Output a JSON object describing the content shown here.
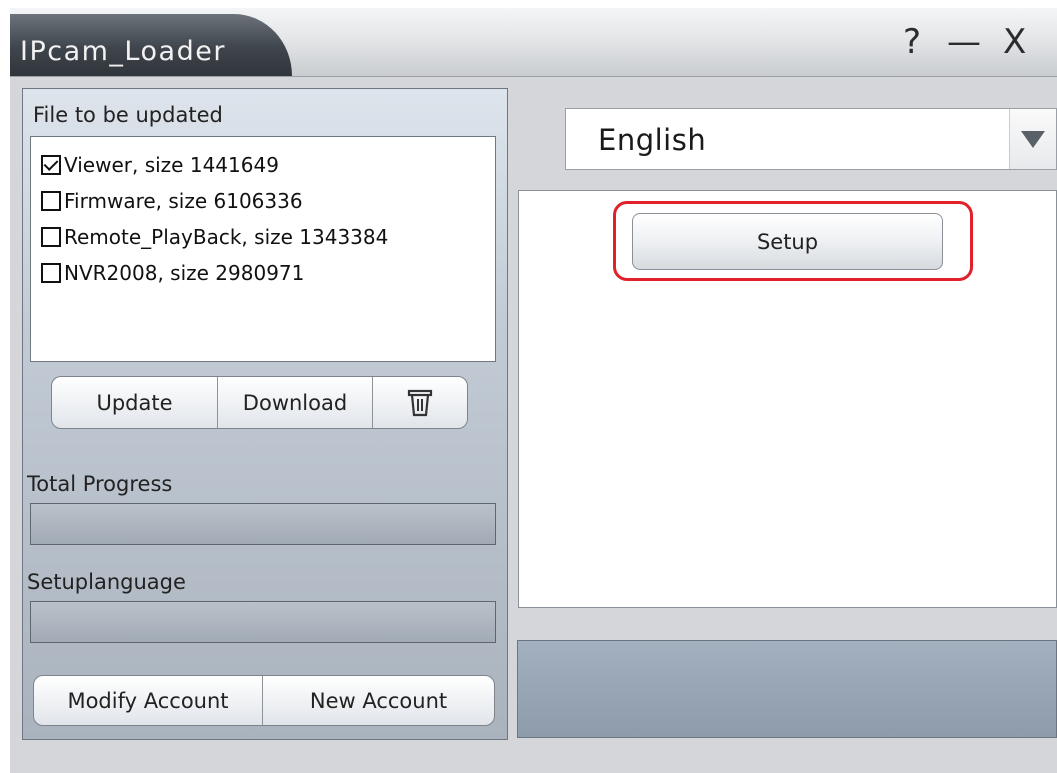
{
  "window": {
    "title": "IPcam_Loader",
    "controls": {
      "help": "?",
      "minimize": "—",
      "close": "X"
    }
  },
  "files": {
    "heading": "File to be updated",
    "items": [
      {
        "label": "Viewer, size 1441649",
        "checked": true
      },
      {
        "label": "Firmware, size 6106336",
        "checked": false
      },
      {
        "label": "Remote_PlayBack, size 1343384",
        "checked": false
      },
      {
        "label": "NVR2008, size 2980971",
        "checked": false
      }
    ]
  },
  "actions": {
    "update_label": "Update",
    "download_label": "Download",
    "delete_icon": "trash-icon"
  },
  "progress": {
    "total_label": "Total Progress",
    "setuplanguage_label": "Setuplanguage"
  },
  "account": {
    "modify_label": "Modify Account",
    "new_label": "New Account"
  },
  "language": {
    "selected": "English"
  },
  "setup": {
    "label": "Setup",
    "highlight_color": "#e0202a"
  }
}
